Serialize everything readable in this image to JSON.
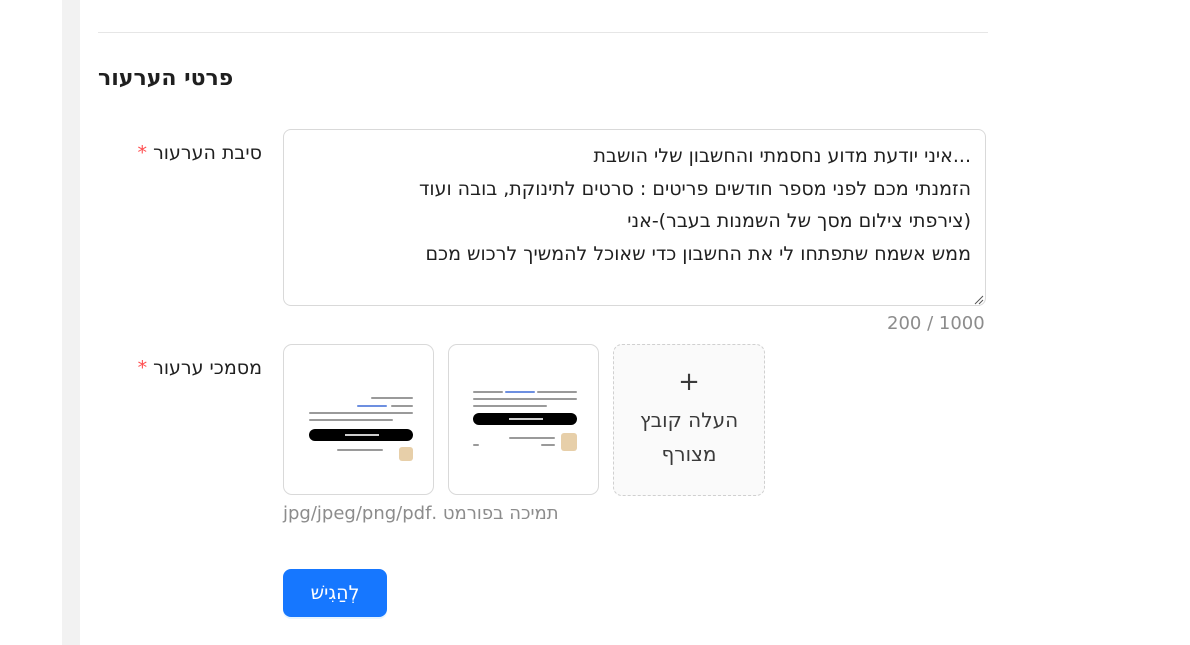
{
  "section": {
    "title": "פרטי הערעור"
  },
  "reason": {
    "label": "סיבת הערעור",
    "required_mark": "*",
    "value": "...איני יודעת מדוע נחסמתי והחשבון שלי הושבת\nהזמנתי מכם לפני מספר חודשים פריטים : סרטים לתינוקת, בובה ועוד\n(צירפתי צילום מסך של השמנות בעבר)-אני\nממש אשמח שתפתחו לי את החשבון כדי שאוכל להמשיך לרכוש מכם",
    "counter": "200 / 1000"
  },
  "documents": {
    "label": "מסמכי ערעור",
    "required_mark": "*",
    "upload_icon": "plus-icon",
    "upload_label": "העלה קובץ מצורף",
    "hint": "תמיכה בפורמט .jpg/jpeg/png/pdf"
  },
  "submit": {
    "label": "לְהַגִישׁ"
  },
  "colors": {
    "accent": "#1677ff",
    "required": "#ff4d4f",
    "muted": "#8c8c8c",
    "border": "#d9d9d9"
  }
}
